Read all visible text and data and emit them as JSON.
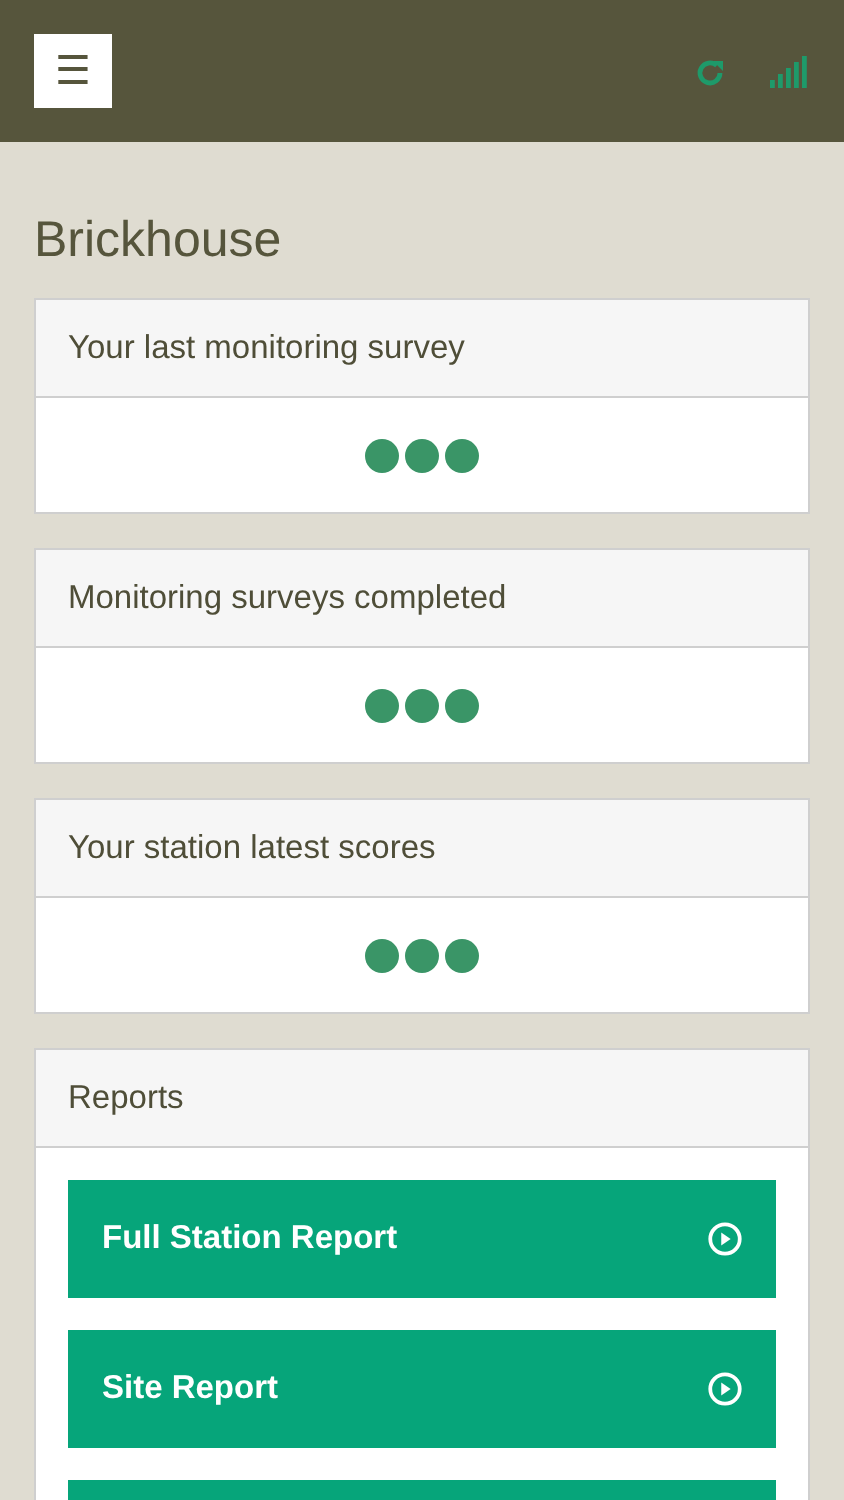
{
  "header": {
    "menu_icon": "☰"
  },
  "title": "Brickhouse",
  "cards": [
    {
      "title": "Your last monitoring survey",
      "loading": true
    },
    {
      "title": "Monitoring surveys completed",
      "loading": true
    },
    {
      "title": "Your station latest scores",
      "loading": true
    }
  ],
  "reports": {
    "title": "Reports",
    "buttons": [
      {
        "kind": "button",
        "label": "Full Station Report"
      },
      {
        "kind": "button",
        "label": "Site Report"
      },
      {
        "kind": "cut-off"
      }
    ]
  }
}
